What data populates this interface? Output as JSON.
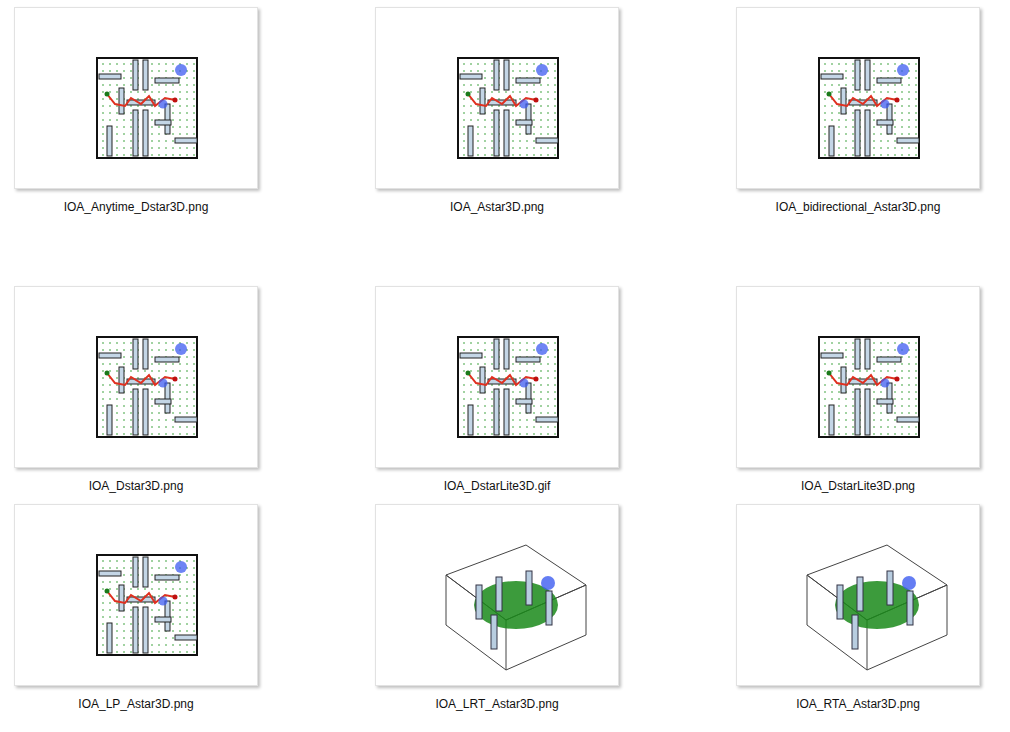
{
  "files": [
    {
      "name": "IOA_Anytime_Dstar3D.png",
      "kind": "topdown"
    },
    {
      "name": "IOA_Astar3D.png",
      "kind": "topdown"
    },
    {
      "name": "IOA_bidirectional_Astar3D.png",
      "kind": "topdown"
    },
    {
      "name": "IOA_Dstar3D.png",
      "kind": "topdown"
    },
    {
      "name": "IOA_DstarLite3D.gif",
      "kind": "topdown"
    },
    {
      "name": "IOA_DstarLite3D.png",
      "kind": "topdown"
    },
    {
      "name": "IOA_LP_Astar3D.png",
      "kind": "topdown"
    },
    {
      "name": "IOA_LRT_Astar3D.png",
      "kind": "3d"
    },
    {
      "name": "IOA_RTA_Astar3D.png",
      "kind": "3d"
    }
  ]
}
